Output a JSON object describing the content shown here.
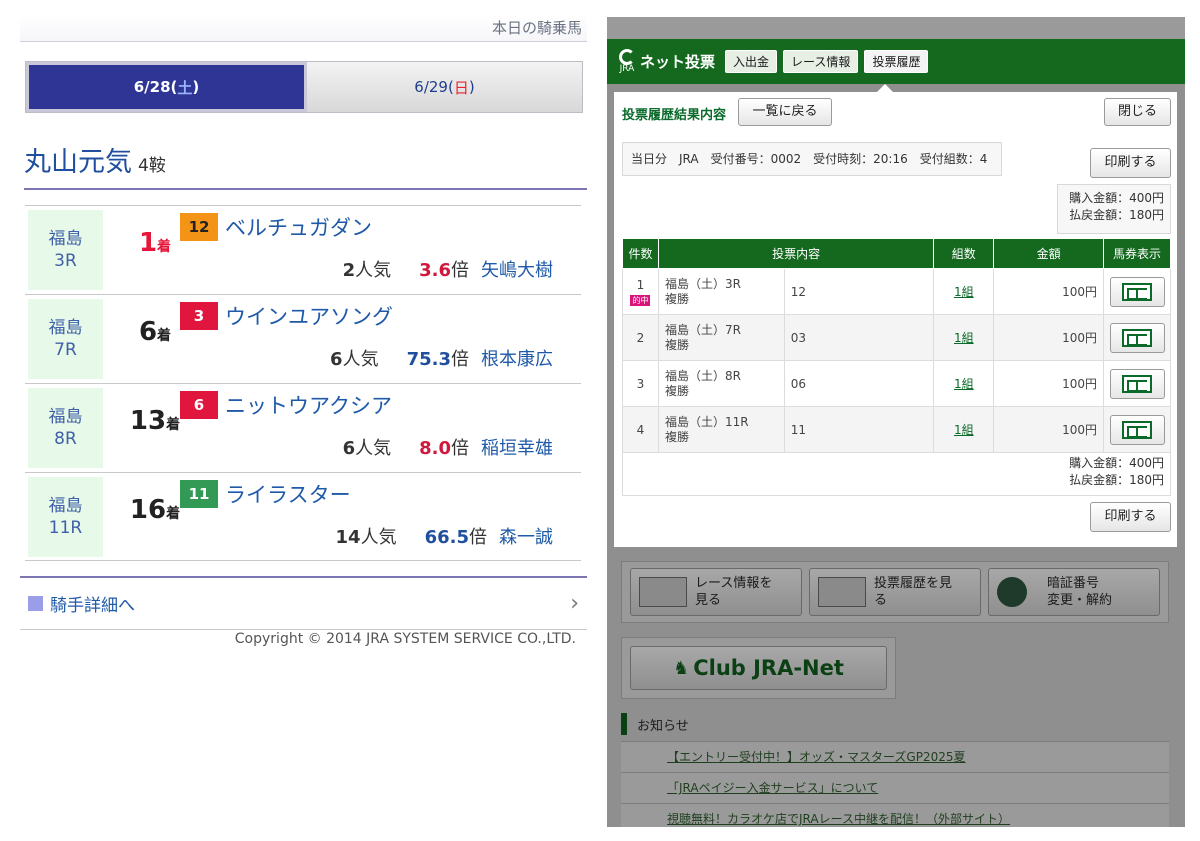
{
  "left": {
    "header": "本日の騎乗馬",
    "date_tabs": [
      {
        "date": "6/28(",
        "day": "土",
        "close": ")"
      },
      {
        "date": "6/29(",
        "day": "日",
        "close": ")"
      }
    ],
    "jockey": {
      "name": "丸山元気",
      "count": "4鞍"
    },
    "races": [
      {
        "place": "福島",
        "race": "3R",
        "rank": "1",
        "rank_unit": "着",
        "waku": "12",
        "horse": "ベルチュガダン",
        "pop": "2",
        "pop_unit": "人気",
        "odds": "3.6",
        "odds_unit": "倍",
        "rider": "矢嶋大樹"
      },
      {
        "place": "福島",
        "race": "7R",
        "rank": "6",
        "rank_unit": "着",
        "waku": "3",
        "horse": "ウインユアソング",
        "pop": "6",
        "pop_unit": "人気",
        "odds": "75.3",
        "odds_unit": "倍",
        "rider": "根本康広"
      },
      {
        "place": "福島",
        "race": "8R",
        "rank": "13",
        "rank_unit": "着",
        "waku": "6",
        "horse": "ニットウアクシア",
        "pop": "6",
        "pop_unit": "人気",
        "odds": "8.0",
        "odds_unit": "倍",
        "rider": "稲垣幸雄"
      },
      {
        "place": "福島",
        "race": "11R",
        "rank": "16",
        "rank_unit": "着",
        "waku": "11",
        "horse": "ライラスター",
        "pop": "14",
        "pop_unit": "人気",
        "odds": "66.5",
        "odds_unit": "倍",
        "rider": "森一誠"
      }
    ],
    "detail_link": "騎手詳細へ",
    "copyright": "Copyright © 2014 JRA SYSTEM SERVICE CO.,LTD."
  },
  "right": {
    "brand_small": "JRA",
    "brand": "ネット投票",
    "nav": [
      "入出金",
      "レース情報",
      "投票履歴"
    ],
    "dialog": {
      "title": "投票履歴結果内容",
      "back": "一覧に戻る",
      "close": "閉じる",
      "info": "当日分　JRA　受付番号：0002　受付時刻：20:16　受付組数：4",
      "print": "印刷する",
      "purchase": "購入金額：400円",
      "refund": "払戻金額：180円",
      "headers": [
        "件数",
        "投票内容",
        "組数",
        "金額",
        "馬券表示"
      ],
      "rows": [
        {
          "no": "1",
          "hit": "的中",
          "race": "福島（土）3R",
          "type": "複勝",
          "body": "12",
          "count": "1組",
          "amount": "100円"
        },
        {
          "no": "2",
          "hit": "",
          "race": "福島（土）7R",
          "type": "複勝",
          "body": "03",
          "count": "1組",
          "amount": "100円"
        },
        {
          "no": "3",
          "hit": "",
          "race": "福島（土）8R",
          "type": "複勝",
          "body": "06",
          "count": "1組",
          "amount": "100円"
        },
        {
          "no": "4",
          "hit": "",
          "race": "福島（土）11R",
          "type": "複勝",
          "body": "11",
          "count": "1組",
          "amount": "100円"
        }
      ]
    },
    "menu": [
      {
        "line1": "レース情報を",
        "line2": "見る"
      },
      {
        "line1": "投票履歴を見",
        "line2": "る"
      },
      {
        "line1": "暗証番号",
        "line2": "変更・解約"
      }
    ],
    "club": "Club JRA-Net",
    "news_title": "お知らせ",
    "news": [
      "【エントリー受付中！】オッズ・マスターズGP2025夏",
      "「JRAペイジー入金サービス」について",
      "視聴無料！カラオケ店でJRAレース中継を配信！（外部サイト）"
    ]
  }
}
